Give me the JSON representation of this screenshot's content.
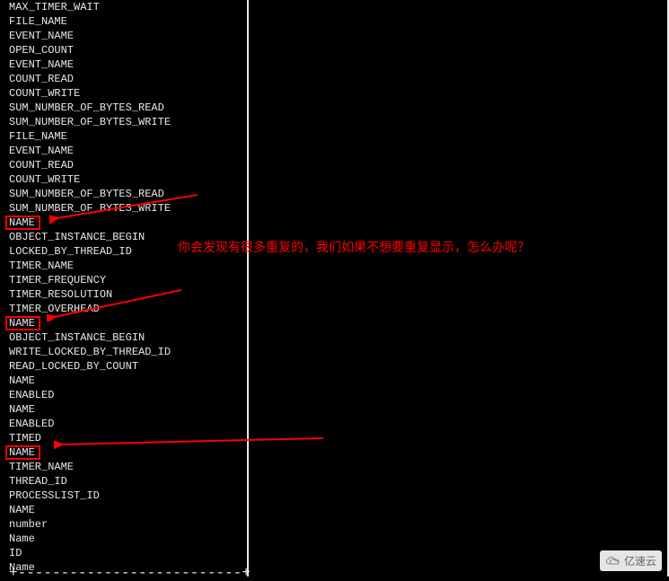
{
  "terminal": {
    "lines": [
      {
        "text": "MAX_TIMER_WAIT",
        "boxed": false
      },
      {
        "text": "FILE_NAME",
        "boxed": false
      },
      {
        "text": "EVENT_NAME",
        "boxed": false
      },
      {
        "text": "OPEN_COUNT",
        "boxed": false
      },
      {
        "text": "EVENT_NAME",
        "boxed": false
      },
      {
        "text": "COUNT_READ",
        "boxed": false
      },
      {
        "text": "COUNT_WRITE",
        "boxed": false
      },
      {
        "text": "SUM_NUMBER_OF_BYTES_READ",
        "boxed": false
      },
      {
        "text": "SUM_NUMBER_OF_BYTES_WRITE",
        "boxed": false
      },
      {
        "text": "FILE_NAME",
        "boxed": false
      },
      {
        "text": "EVENT_NAME",
        "boxed": false
      },
      {
        "text": "COUNT_READ",
        "boxed": false
      },
      {
        "text": "COUNT_WRITE",
        "boxed": false
      },
      {
        "text": "SUM_NUMBER_OF_BYTES_READ",
        "boxed": false
      },
      {
        "text": "SUM_NUMBER_OF_BYTES_WRITE",
        "boxed": false
      },
      {
        "text": "NAME",
        "boxed": true
      },
      {
        "text": "OBJECT_INSTANCE_BEGIN",
        "boxed": false
      },
      {
        "text": "LOCKED_BY_THREAD_ID",
        "boxed": false
      },
      {
        "text": "TIMER_NAME",
        "boxed": false
      },
      {
        "text": "TIMER_FREQUENCY",
        "boxed": false
      },
      {
        "text": "TIMER_RESOLUTION",
        "boxed": false
      },
      {
        "text": "TIMER_OVERHEAD",
        "boxed": false
      },
      {
        "text": "NAME",
        "boxed": true
      },
      {
        "text": "OBJECT_INSTANCE_BEGIN",
        "boxed": false
      },
      {
        "text": "WRITE_LOCKED_BY_THREAD_ID",
        "boxed": false
      },
      {
        "text": "READ_LOCKED_BY_COUNT",
        "boxed": false
      },
      {
        "text": "NAME",
        "boxed": false
      },
      {
        "text": "ENABLED",
        "boxed": false
      },
      {
        "text": "NAME",
        "boxed": false
      },
      {
        "text": "ENABLED",
        "boxed": false
      },
      {
        "text": "TIMED",
        "boxed": false
      },
      {
        "text": "NAME",
        "boxed": true
      },
      {
        "text": "TIMER_NAME",
        "boxed": false
      },
      {
        "text": "THREAD_ID",
        "boxed": false
      },
      {
        "text": "PROCESSLIST_ID",
        "boxed": false
      },
      {
        "text": "NAME",
        "boxed": false
      },
      {
        "text": "number",
        "boxed": false
      },
      {
        "text": "Name",
        "boxed": false
      },
      {
        "text": "ID",
        "boxed": false
      },
      {
        "text": "Name",
        "boxed": false
      }
    ],
    "divider": "+--------------------------+"
  },
  "annotation": {
    "text": "你会发现有很多重复的，我们如果不想要重复显示，怎么办呢？"
  },
  "watermark": {
    "text": "亿速云",
    "icon": "cloud-logo-icon"
  },
  "colors": {
    "highlight": "#ff0000",
    "fg": "#e8e8e8",
    "bg": "#000000"
  }
}
